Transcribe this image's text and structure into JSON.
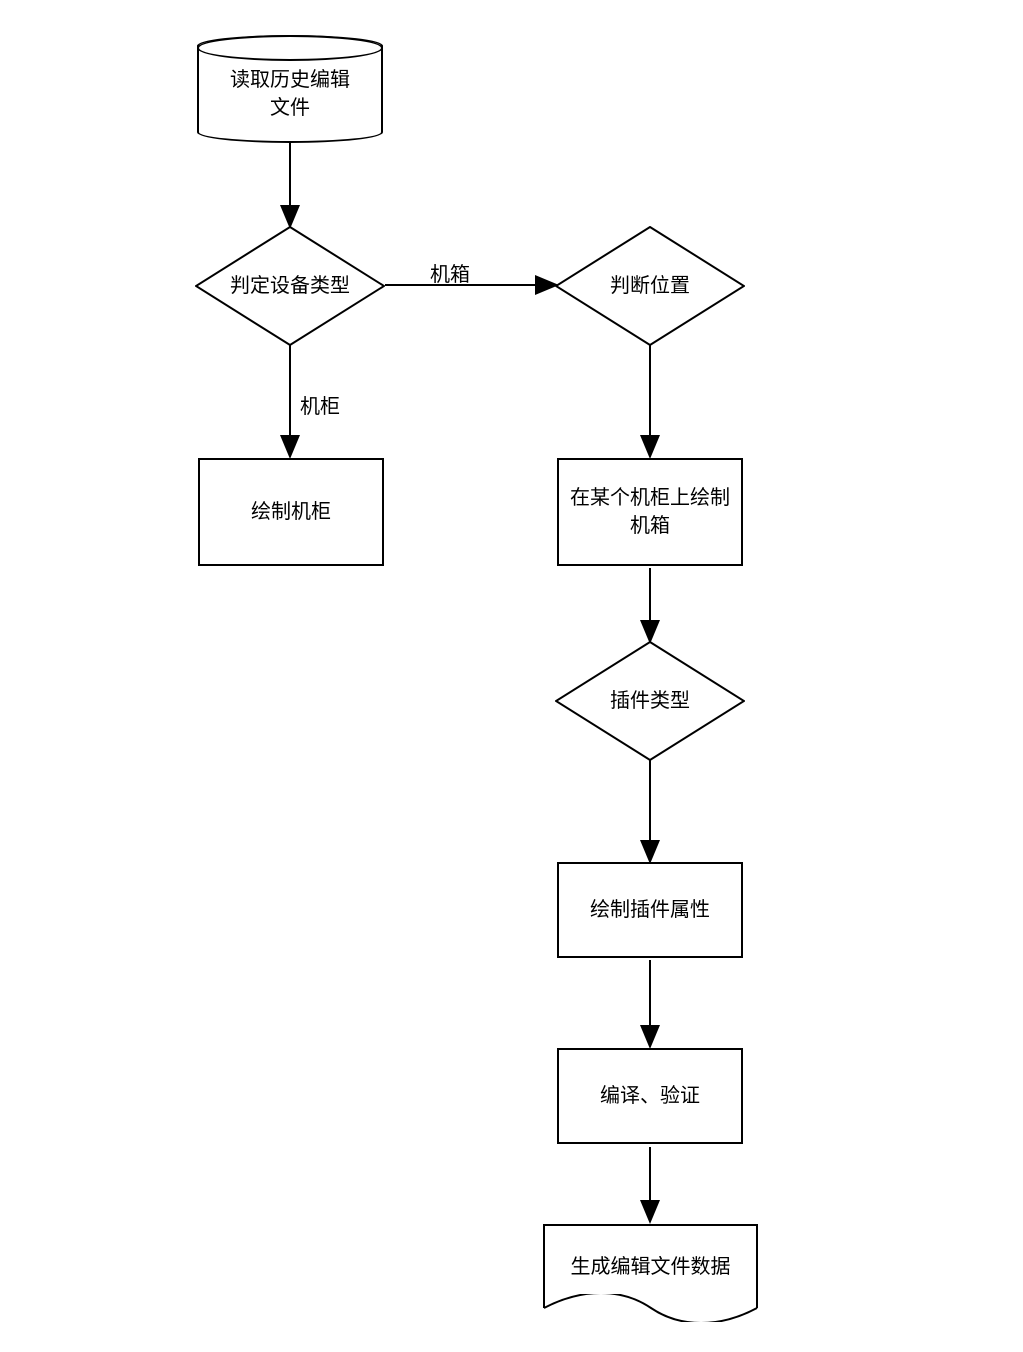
{
  "nodes": {
    "datastore_read": "读取历史编辑\n文件",
    "decide_device_type": "判定设备类型",
    "decide_position": "判断位置",
    "draw_cabinet": "绘制机柜",
    "draw_chassis_on_cabinet": "在某个机柜上绘制\n机箱",
    "plugin_type": "插件类型",
    "draw_plugin_attrs": "绘制插件属性",
    "compile_verify": "编译、验证",
    "generate_edit_file": "生成编辑文件数据"
  },
  "edges": {
    "cabinet": "机柜",
    "chassis": "机箱"
  }
}
